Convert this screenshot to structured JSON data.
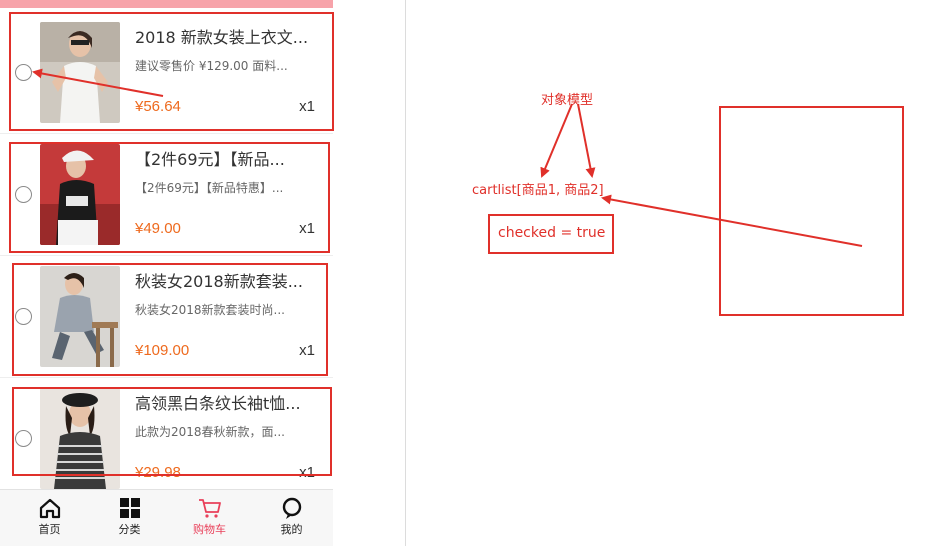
{
  "cart": {
    "items": [
      {
        "title": "2018 新款女装上衣文...",
        "desc": "建议零售价 ¥129.00 面料...",
        "price": "¥56.64",
        "qty": "x1",
        "image": "white-tshirt-woman"
      },
      {
        "title": "【2件69元】【新品...",
        "desc": "【2件69元】【新品特惠】...",
        "price": "¥49.00",
        "qty": "x1",
        "image": "black-tshirt-cap-woman"
      },
      {
        "title": "秋装女2018新款套装...",
        "desc": "秋装女2018新款套装时尚...",
        "price": "¥109.00",
        "qty": "x1",
        "image": "grey-sweater-seated-woman"
      },
      {
        "title": "高领黑白条纹长袖t恤...",
        "desc": "此款为2018春秋新款，面...",
        "price": "¥29.98",
        "qty": "x1",
        "image": "striped-top-beret-woman"
      }
    ]
  },
  "tabbar": {
    "tabs": [
      {
        "label": "首页",
        "icon": "home-icon",
        "active": false
      },
      {
        "label": "分类",
        "icon": "grid-icon",
        "active": false
      },
      {
        "label": "购物车",
        "icon": "cart-icon",
        "active": true
      },
      {
        "label": "我的",
        "icon": "user-icon",
        "active": false
      }
    ]
  },
  "annotations": {
    "object_model": "对象模型",
    "cartlist": "cartlist[商品1, 商品2]",
    "checked": "checked = true"
  },
  "colors": {
    "price": "#ee6a1e",
    "annotation_red": "#e0302a",
    "active_tab": "#e9405a",
    "header_pink": "#f7a3aa"
  }
}
